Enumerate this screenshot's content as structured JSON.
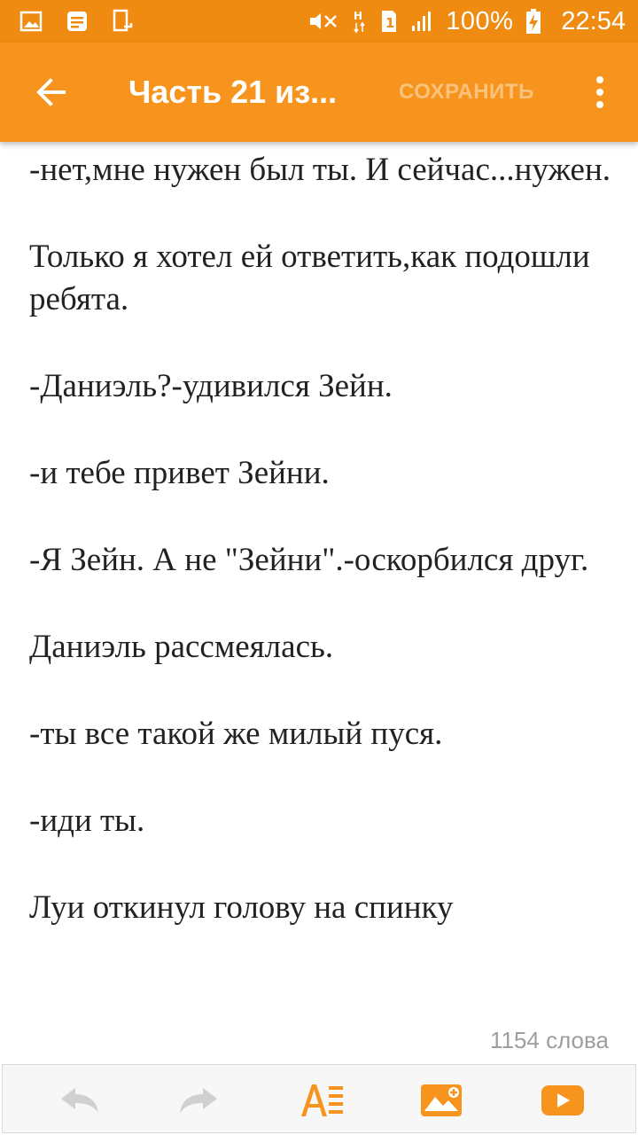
{
  "status_bar": {
    "battery_percent": "100%",
    "time": "22:54"
  },
  "app_bar": {
    "title": "Часть 21 из...",
    "save_label": "СОХРАНИТЬ",
    "accent_color": "#f7941d"
  },
  "content": {
    "paragraphs": [
      "-нет,мне нужен был ты. И сейчас...нужен.",
      "Только я хотел ей ответить,как подошли ребята.",
      "-Даниэль?-удивился Зейн.",
      "-и тебе привет Зейни.",
      "-Я Зейн. А не \"Зейни\".-оскорбился друг.",
      "Даниэль рассмеялась.",
      "-ты все такой же милый пуся.",
      "-иди ты.",
      "Луи откинул голову на спинку"
    ],
    "word_count": "1154 слова"
  },
  "toolbar": {
    "icons": [
      "undo-icon",
      "redo-icon",
      "text-format-icon",
      "insert-image-icon",
      "insert-video-icon"
    ]
  }
}
